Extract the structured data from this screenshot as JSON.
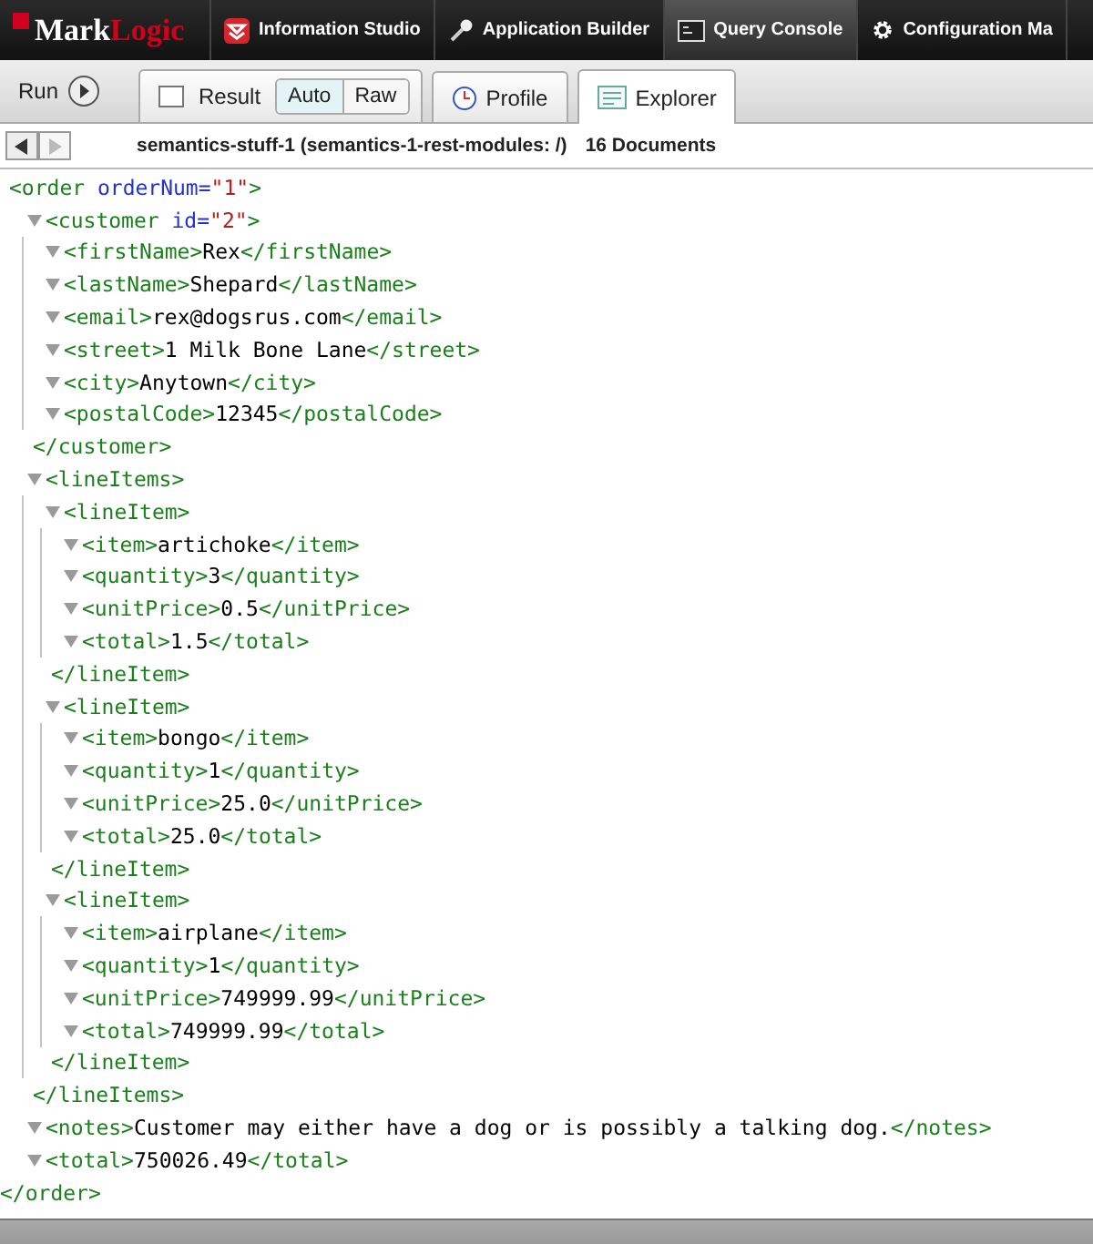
{
  "app_bar": {
    "logo": {
      "part_1": "Mark",
      "part_2": "Logic"
    },
    "tabs": [
      {
        "label": "Information Studio",
        "kind": "studio",
        "selected": false
      },
      {
        "label": "Application Builder",
        "kind": "builder",
        "selected": false
      },
      {
        "label": "Query Console",
        "kind": "console",
        "selected": true
      },
      {
        "label": "Configuration Ma",
        "kind": "config",
        "selected": false
      }
    ]
  },
  "toolbar": {
    "run_label": "Run",
    "result_tab": {
      "label": "Result",
      "selected": false,
      "modes": [
        {
          "label": "Auto",
          "selected": true
        },
        {
          "label": "Raw",
          "selected": false
        }
      ]
    },
    "tabs": [
      {
        "label": "Profile",
        "kind": "profile",
        "selected": false
      },
      {
        "label": "Explorer",
        "kind": "explorer",
        "selected": true
      }
    ]
  },
  "path_bar": {
    "back_disabled": false,
    "forward_disabled": true,
    "location": "semantics-stuff-1 (semantics-1-rest-modules: /)",
    "count": "16 Documents"
  },
  "xml": {
    "start": "<order",
    "attrs": [
      {
        "name": "orderNum=",
        "value": "\"1\""
      }
    ],
    "end": ">",
    "close": "</order>",
    "children": [
      {
        "start": "<customer",
        "expanded": true,
        "attrs": [
          {
            "name": "id=",
            "value": "\"2\""
          }
        ],
        "end": ">",
        "close": "</customer>",
        "children": [
          {
            "start": "<firstName>",
            "expanded": true,
            "text": "Rex",
            "close": "</firstName>"
          },
          {
            "start": "<lastName>",
            "expanded": true,
            "text": "Shepard",
            "close": "</lastName>"
          },
          {
            "start": "<email>",
            "expanded": true,
            "text": "rex@dogsrus.com",
            "close": "</email>"
          },
          {
            "start": "<street>",
            "expanded": true,
            "text": "1 Milk Bone Lane",
            "close": "</street>"
          },
          {
            "start": "<city>",
            "expanded": true,
            "text": "Anytown",
            "close": "</city>"
          },
          {
            "start": "<postalCode>",
            "expanded": true,
            "text": "12345",
            "close": "</postalCode>"
          }
        ]
      },
      {
        "start": "<lineItems>",
        "expanded": true,
        "close": "</lineItems>",
        "children": [
          {
            "start": "<lineItem>",
            "expanded": true,
            "close": "</lineItem>",
            "children": [
              {
                "start": "<item>",
                "expanded": true,
                "text": "artichoke",
                "close": "</item>"
              },
              {
                "start": "<quantity>",
                "expanded": true,
                "text": "3",
                "close": "</quantity>"
              },
              {
                "start": "<unitPrice>",
                "expanded": true,
                "text": "0.5",
                "close": "</unitPrice>"
              },
              {
                "start": "<total>",
                "expanded": true,
                "text": "1.5",
                "close": "</total>"
              }
            ]
          },
          {
            "start": "<lineItem>",
            "expanded": true,
            "close": "</lineItem>",
            "children": [
              {
                "start": "<item>",
                "expanded": true,
                "text": "bongo",
                "close": "</item>"
              },
              {
                "start": "<quantity>",
                "expanded": true,
                "text": "1",
                "close": "</quantity>"
              },
              {
                "start": "<unitPrice>",
                "expanded": true,
                "text": "25.0",
                "close": "</unitPrice>"
              },
              {
                "start": "<total>",
                "expanded": true,
                "text": "25.0",
                "close": "</total>"
              }
            ]
          },
          {
            "start": "<lineItem>",
            "expanded": true,
            "close": "</lineItem>",
            "children": [
              {
                "start": "<item>",
                "expanded": true,
                "text": "airplane",
                "close": "</item>"
              },
              {
                "start": "<quantity>",
                "expanded": true,
                "text": "1",
                "close": "</quantity>"
              },
              {
                "start": "<unitPrice>",
                "expanded": true,
                "text": "749999.99",
                "close": "</unitPrice>"
              },
              {
                "start": "<total>",
                "expanded": true,
                "text": "749999.99",
                "close": "</total>"
              }
            ]
          }
        ]
      },
      {
        "start": "<notes>",
        "expanded": true,
        "text": "Customer may either have a dog or is possibly a talking dog.",
        "close": "</notes>"
      },
      {
        "start": "<total>",
        "expanded": true,
        "text": "750026.49",
        "close": "</total>"
      }
    ]
  }
}
